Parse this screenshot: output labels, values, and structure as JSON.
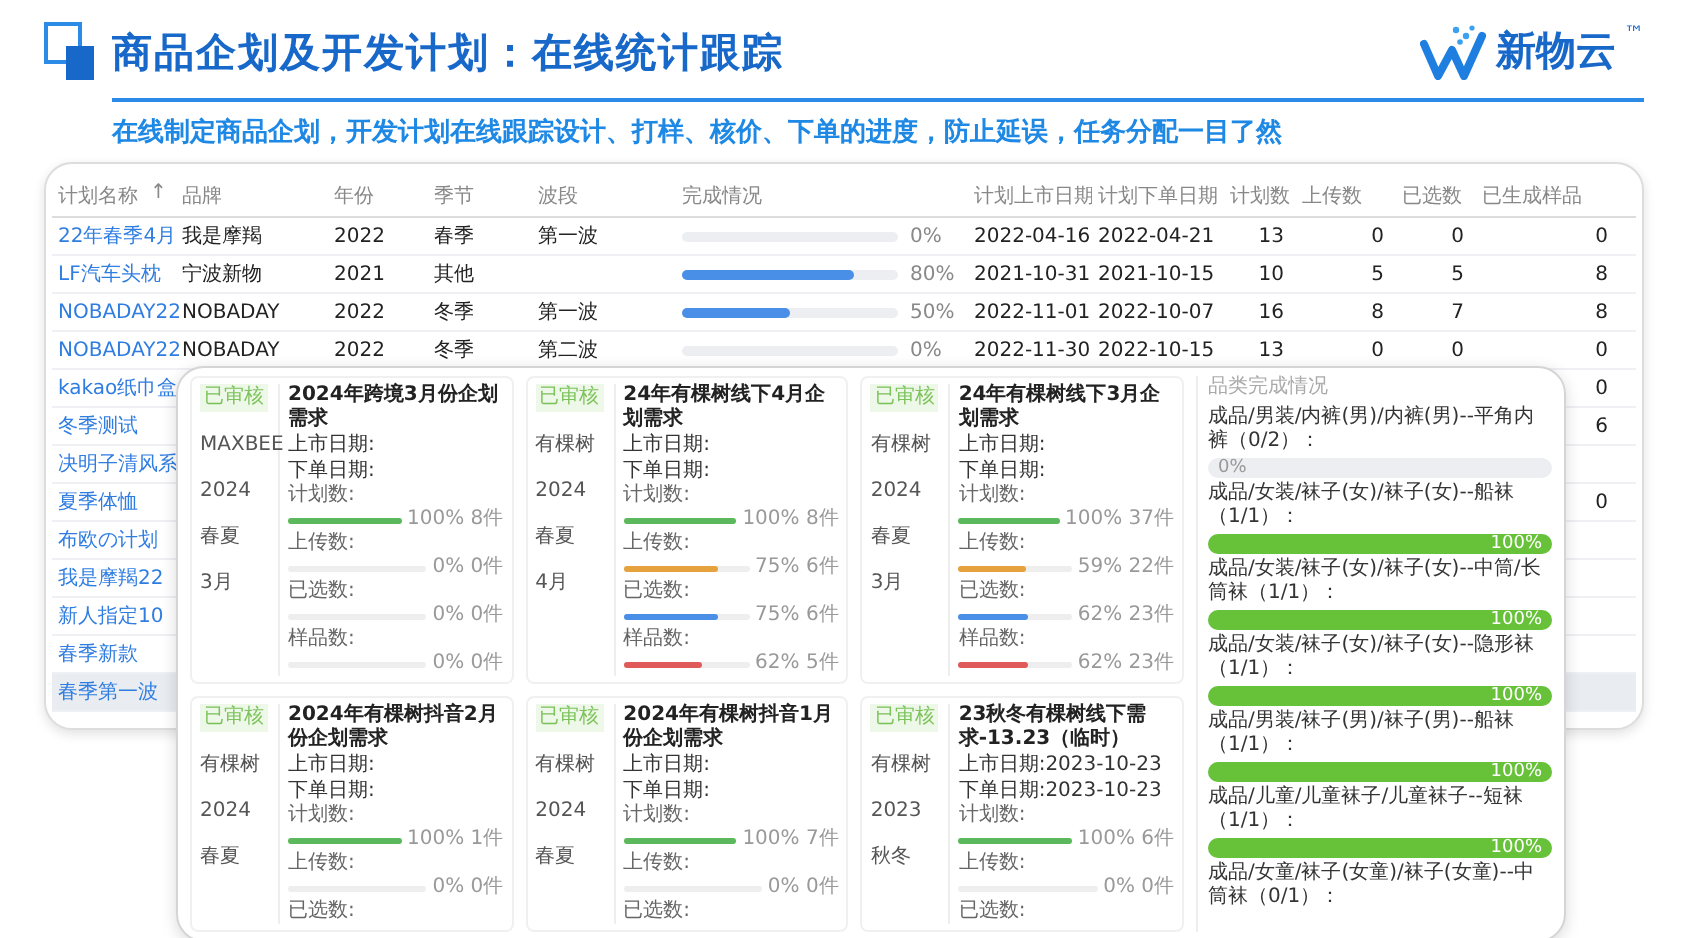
{
  "header": {
    "title": "商品企划及开发计划：在线统计跟踪",
    "logo_text": "新物云",
    "trademark": "™"
  },
  "subtitle": "在线制定商品企划，开发计划在线跟踪设计、打样、核价、下单的进度，防止延误，任务分配一目了然",
  "table": {
    "columns": [
      "计划名称",
      "品牌",
      "年份",
      "季节",
      "波段",
      "完成情况",
      "计划上市日期",
      "计划下单日期",
      "计划数",
      "上传数",
      "已选数",
      "已生成样品"
    ],
    "sort_mark": "↑",
    "rows": [
      {
        "name": "22年春季4月",
        "brand": "我是摩羯",
        "year": "2022",
        "season": "春季",
        "wave": "第一波",
        "level": 0,
        "percent": "0%",
        "launch_date": "2022-04-16",
        "order_date": "2022-04-21",
        "planned": "13",
        "uploaded": "0",
        "chosen": "0",
        "samples": "0",
        "selected": false
      },
      {
        "name": "LF汽车头枕",
        "brand": "宁波新物",
        "year": "2021",
        "season": "其他",
        "level": 0.8,
        "percent": "80%",
        "launch_date": "2021-10-31",
        "order_date": "2021-10-15",
        "planned": "10",
        "uploaded": "5",
        "chosen": "5",
        "samples": "8",
        "selected": false
      },
      {
        "name": "NOBADAY22",
        "brand": "NOBADAY",
        "year": "2022",
        "season": "冬季",
        "wave": "第一波",
        "level": 0.5,
        "percent": "50%",
        "launch_date": "2022-11-01",
        "order_date": "2022-10-07",
        "planned": "16",
        "uploaded": "8",
        "chosen": "7",
        "samples": "8",
        "selected": false
      },
      {
        "name": "NOBADAY22",
        "brand": "NOBADAY",
        "year": "2022",
        "season": "冬季",
        "wave": "第二波",
        "level": 0,
        "percent": "0%",
        "launch_date": "2022-11-30",
        "order_date": "2022-10-15",
        "planned": "13",
        "uploaded": "0",
        "chosen": "0",
        "samples": "0",
        "selected": false
      },
      {
        "name": "kakao纸巾盒",
        "samples": "0",
        "selected": false
      },
      {
        "name": "冬季测试",
        "samples": "6",
        "selected": false
      },
      {
        "name": "决明子清风系",
        "selected": false
      },
      {
        "name": "夏季体恤",
        "samples": "0",
        "selected": false
      },
      {
        "name": "布欧の计划",
        "selected": false
      },
      {
        "name": "我是摩羯22",
        "selected": false
      },
      {
        "name": "新人指定10",
        "selected": false
      },
      {
        "name": "春季新款",
        "selected": false
      },
      {
        "name": "春季第一波",
        "selected": true
      }
    ]
  },
  "cards": [
    {
      "status": "已审核",
      "brand": "MAXBEE",
      "year": "2024",
      "season": "春夏",
      "month": "3月",
      "title": "2024年跨境3月份企划需求",
      "launch": "上市日期:",
      "order": "下单日期:",
      "metrics": [
        {
          "kind": "plan",
          "label": "计划数:",
          "level": 1,
          "reading": "100% 8件"
        },
        {
          "kind": "upload",
          "label": "上传数:",
          "level": 0,
          "reading": "0% 0件"
        },
        {
          "kind": "chosen",
          "label": "已选数:",
          "level": 0,
          "reading": "0% 0件"
        },
        {
          "kind": "sample",
          "label": "样品数:",
          "level": 0,
          "reading": "0% 0件"
        }
      ]
    },
    {
      "status": "已审核",
      "brand": "有棵树",
      "year": "2024",
      "season": "春夏",
      "month": "4月",
      "title": "24年有棵树线下4月企划需求",
      "launch": "上市日期:",
      "order": "下单日期:",
      "metrics": [
        {
          "kind": "plan",
          "label": "计划数:",
          "level": 1,
          "reading": "100% 8件"
        },
        {
          "kind": "upload",
          "label": "上传数:",
          "level": 0.75,
          "reading": "75% 6件"
        },
        {
          "kind": "chosen",
          "label": "已选数:",
          "level": 0.75,
          "reading": "75% 6件"
        },
        {
          "kind": "sample",
          "label": "样品数:",
          "level": 0.62,
          "reading": "62% 5件"
        }
      ]
    },
    {
      "status": "已审核",
      "brand": "有棵树",
      "year": "2024",
      "season": "春夏",
      "month": "3月",
      "title": "24年有棵树线下3月企划需求",
      "launch": "上市日期:",
      "order": "下单日期:",
      "metrics": [
        {
          "kind": "plan",
          "label": "计划数:",
          "level": 1,
          "reading": "100% 37件"
        },
        {
          "kind": "upload",
          "label": "上传数:",
          "level": 0.59,
          "reading": "59% 22件"
        },
        {
          "kind": "chosen",
          "label": "已选数:",
          "level": 0.62,
          "reading": "62% 23件"
        },
        {
          "kind": "sample",
          "label": "样品数:",
          "level": 0.62,
          "reading": "62% 23件"
        }
      ]
    },
    {
      "status": "已审核",
      "brand": "有棵树",
      "year": "2024",
      "season": "春夏",
      "title": "2024年有棵树抖音2月份企划需求",
      "launch": "上市日期:",
      "order": "下单日期:",
      "metrics": [
        {
          "kind": "plan",
          "label": "计划数:",
          "level": 1,
          "reading": "100% 1件"
        },
        {
          "kind": "upload",
          "label": "上传数:",
          "level": 0,
          "reading": "0% 0件"
        },
        {
          "kind": "chosen",
          "label": "已选数:"
        }
      ]
    },
    {
      "status": "已审核",
      "brand": "有棵树",
      "year": "2024",
      "season": "春夏",
      "title": "2024年有棵树抖音1月份企划需求",
      "launch": "上市日期:",
      "order": "下单日期:",
      "metrics": [
        {
          "kind": "plan",
          "label": "计划数:",
          "level": 1,
          "reading": "100% 7件"
        },
        {
          "kind": "upload",
          "label": "上传数:",
          "level": 0,
          "reading": "0% 0件"
        },
        {
          "kind": "chosen",
          "label": "已选数:"
        }
      ]
    },
    {
      "status": "已审核",
      "brand": "有棵树",
      "year": "2023",
      "season": "秋冬",
      "title": "23秋冬有棵树线下需求-13.23（临时）",
      "launch": "上市日期:2023-10-23",
      "order": "下单日期:2023-10-23",
      "metrics": [
        {
          "kind": "plan",
          "label": "计划数:",
          "level": 1,
          "reading": "100% 6件"
        },
        {
          "kind": "upload",
          "label": "上传数:",
          "level": 0,
          "reading": "0% 0件"
        },
        {
          "kind": "chosen",
          "label": "已选数:"
        }
      ]
    }
  ],
  "category_panel": {
    "title": "品类完成情况",
    "items": [
      {
        "label": "成品/男装/内裤(男)/内裤(男)--平角内裤（0/2）：",
        "level": 0,
        "reading": "0%"
      },
      {
        "label": "成品/女装/袜子(女)/袜子(女)--船袜（1/1）：",
        "level": 1,
        "reading": "100%"
      },
      {
        "label": "成品/女装/袜子(女)/袜子(女)--中筒/长筒袜（1/1）：",
        "level": 1,
        "reading": "100%"
      },
      {
        "label": "成品/女装/袜子(女)/袜子(女)--隐形袜（1/1）：",
        "level": 1,
        "reading": "100%"
      },
      {
        "label": "成品/男装/袜子(男)/袜子(男)--船袜（1/1）：",
        "level": 1,
        "reading": "100%"
      },
      {
        "label": "成品/儿童/儿童袜子/儿童袜子--短袜（1/1）：",
        "level": 1,
        "reading": "100%"
      },
      {
        "label": "成品/女童/袜子(女童)/袜子(女童)--中筒袜（0/1）："
      }
    ]
  }
}
